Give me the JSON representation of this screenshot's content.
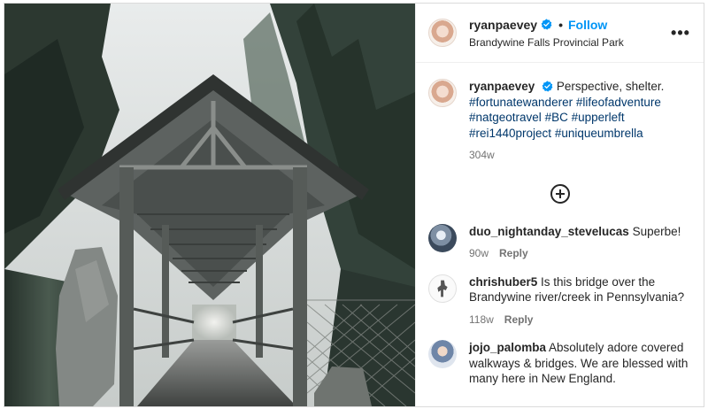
{
  "post": {
    "username": "ryanpaevey",
    "follow_label": "Follow",
    "separator": "•",
    "location": "Brandywine Falls Provincial Park",
    "more_label": "•••"
  },
  "caption": {
    "username": "ryanpaevey",
    "text": "Perspective, shelter.",
    "hashtags": [
      "#fortunatewanderer",
      "#lifeofadventure",
      "#natgeotravel",
      "#BC",
      "#upperleft",
      "#rei1440project",
      "#uniqueumbrella"
    ],
    "time": "304w"
  },
  "comments": [
    {
      "username": "duo_nightanday_stevelucas",
      "text": "Superbe!",
      "time": "90w",
      "reply": "Reply"
    },
    {
      "username": "chrishuber5",
      "text": "Is this bridge over the Brandywine river/creek in Pennsylvania?",
      "time": "118w",
      "reply": "Reply"
    },
    {
      "username": "jojo_palomba",
      "text": "Absolutely adore covered walkways & bridges. We are blessed with many here in New England."
    }
  ],
  "icons": {
    "verified": "verified-badge-icon",
    "more": "more-options-icon",
    "add_comment": "add-circle-icon"
  },
  "colors": {
    "link_blue": "#0095f6",
    "hashtag": "#00376b",
    "muted": "#737373",
    "text": "#262626",
    "border": "#dbdbdb"
  }
}
